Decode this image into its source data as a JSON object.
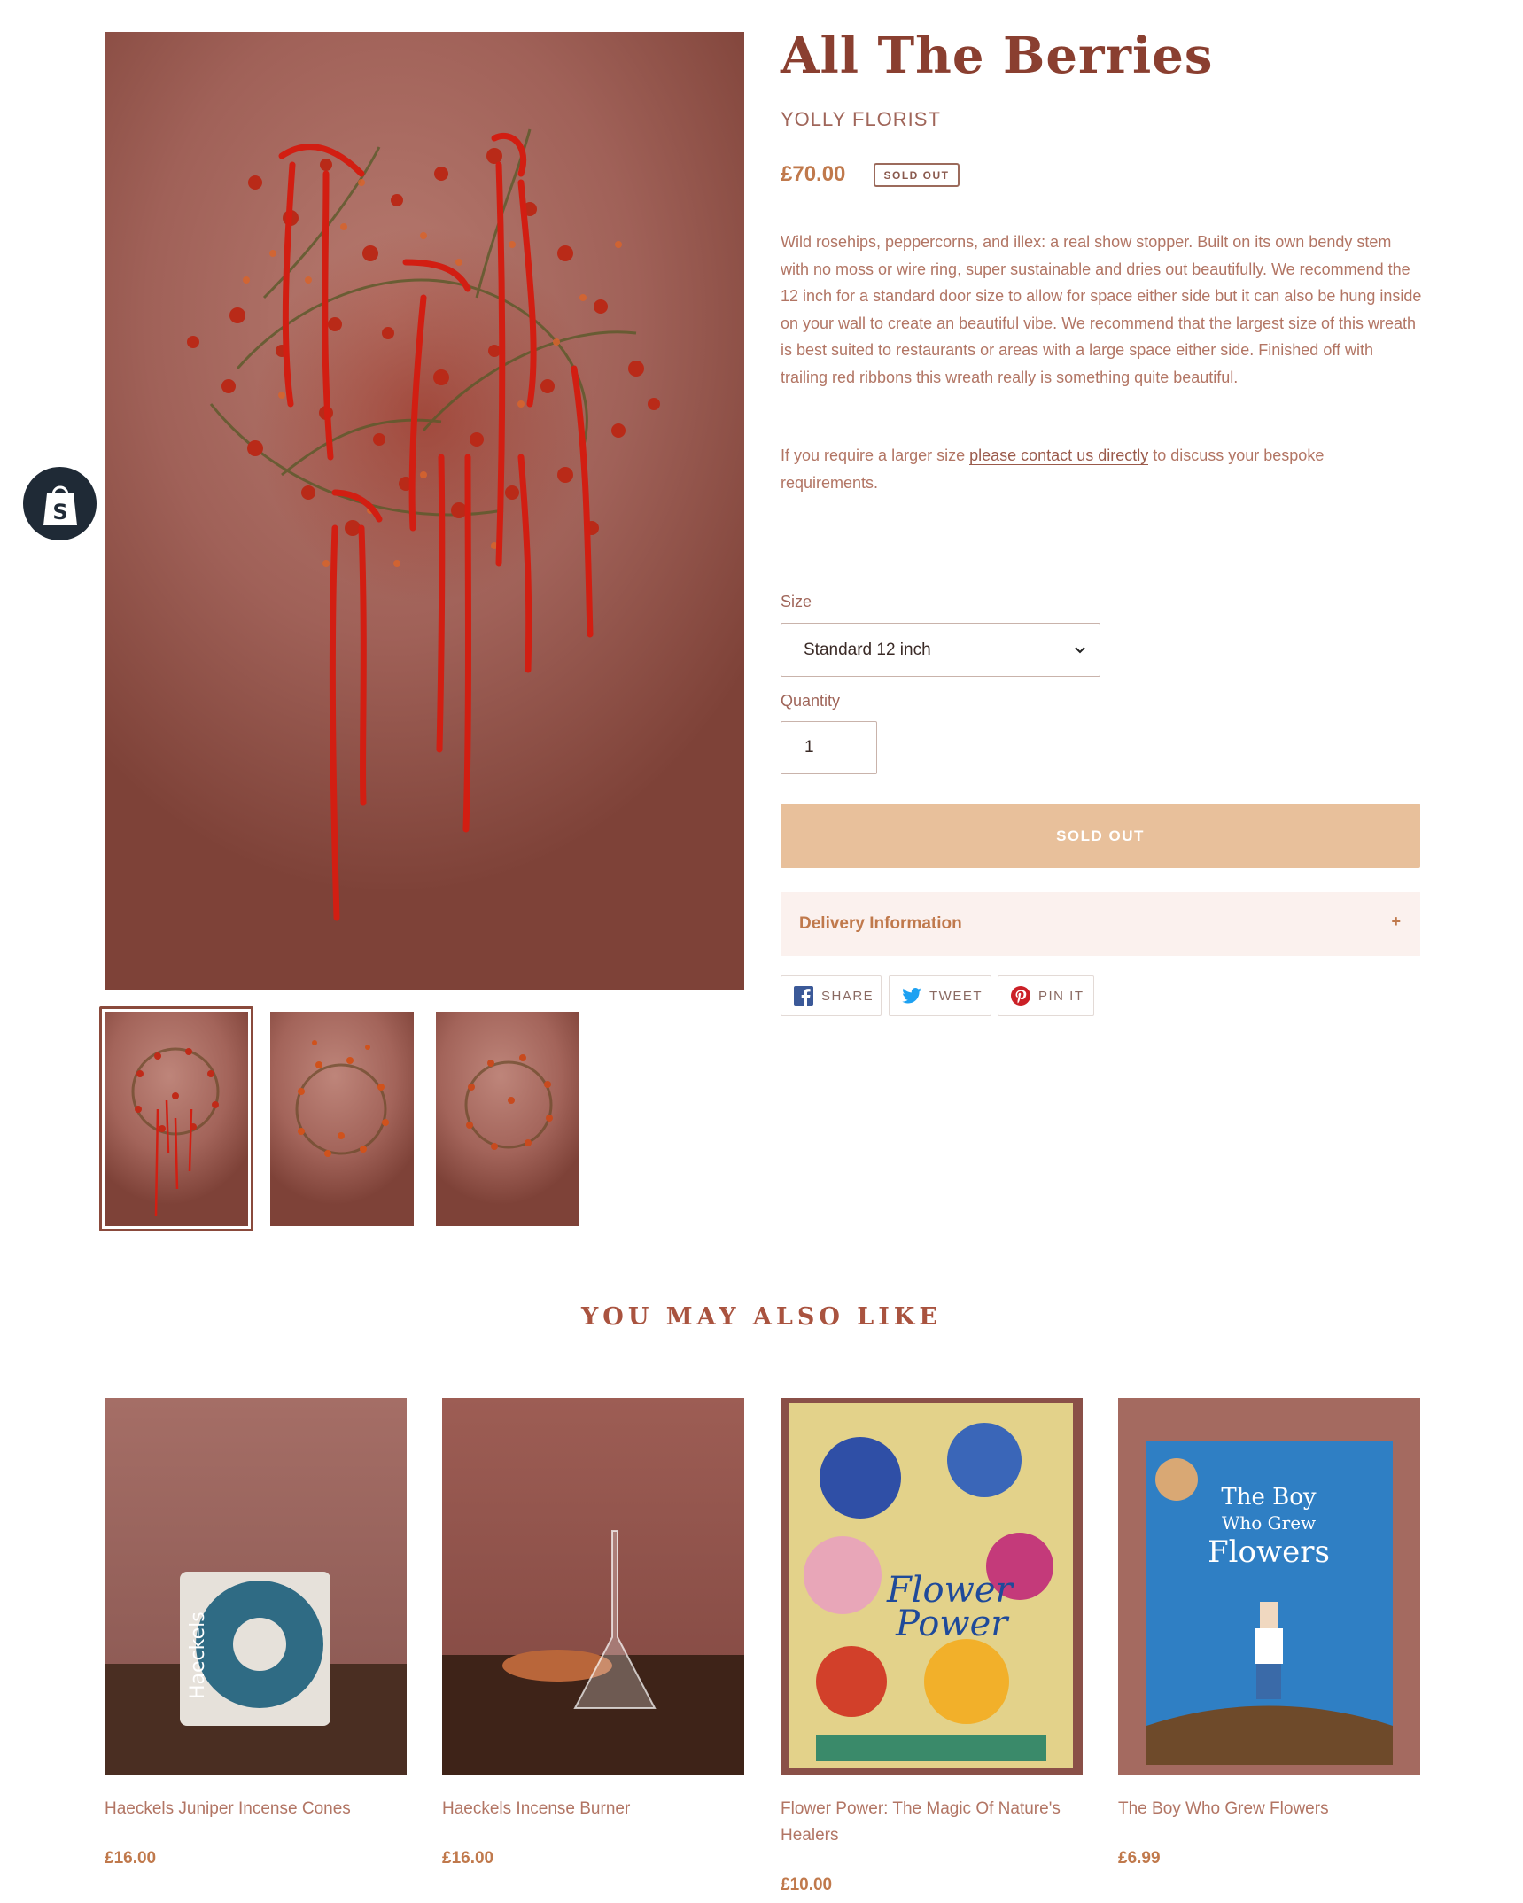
{
  "product": {
    "title": "All The Berries",
    "vendor": "YOLLY FLORIST",
    "price": "£70.00",
    "badge": "SOLD OUT",
    "description": "Wild rosehips, peppercorns, and illex: a real show stopper. Built on its own bendy stem with no moss or wire ring, super sustainable and dries out beautifully. We recommend the 12 inch for a standard door size to allow for space either side but it can also be hung inside on your wall to create an beautiful vibe. We recommend that the largest size of this wreath is best suited to restaurants or areas with a large space either side. Finished off with trailing red ribbons this wreath really is something quite beautiful.",
    "contact_before": "If you require a larger size ",
    "contact_link": "please contact us directly",
    "contact_after": " to discuss your bespoke requirements.",
    "size_label": "Size",
    "size_value": "Standard 12 inch",
    "quantity_label": "Quantity",
    "quantity_value": "1",
    "button_label": "SOLD OUT",
    "delivery_label": "Delivery Information",
    "delivery_toggle": "+",
    "share": [
      {
        "label": "SHARE",
        "icon": "facebook-icon"
      },
      {
        "label": "TWEET",
        "icon": "twitter-icon"
      },
      {
        "label": "PIN IT",
        "icon": "pinterest-icon"
      }
    ],
    "thumbnails": 3,
    "selected_thumbnail": 1
  },
  "related": {
    "heading": "YOU MAY ALSO LIKE",
    "items": [
      {
        "title": "Haeckels Juniper Incense Cones",
        "price": "£16.00"
      },
      {
        "title": "Haeckels Incense Burner",
        "price": "£16.00"
      },
      {
        "title": "Flower Power: The Magic Of Nature's Healers",
        "price": "£10.00"
      },
      {
        "title": "The Boy Who Grew Flowers",
        "price": "£6.99"
      }
    ]
  },
  "colors": {
    "title": "#8a3f30",
    "accent_price": "#c0794c",
    "sold_out_button": "#e8c09b",
    "delivery_bg": "#fbf1ee",
    "shop_badge": "#1f2a36"
  }
}
